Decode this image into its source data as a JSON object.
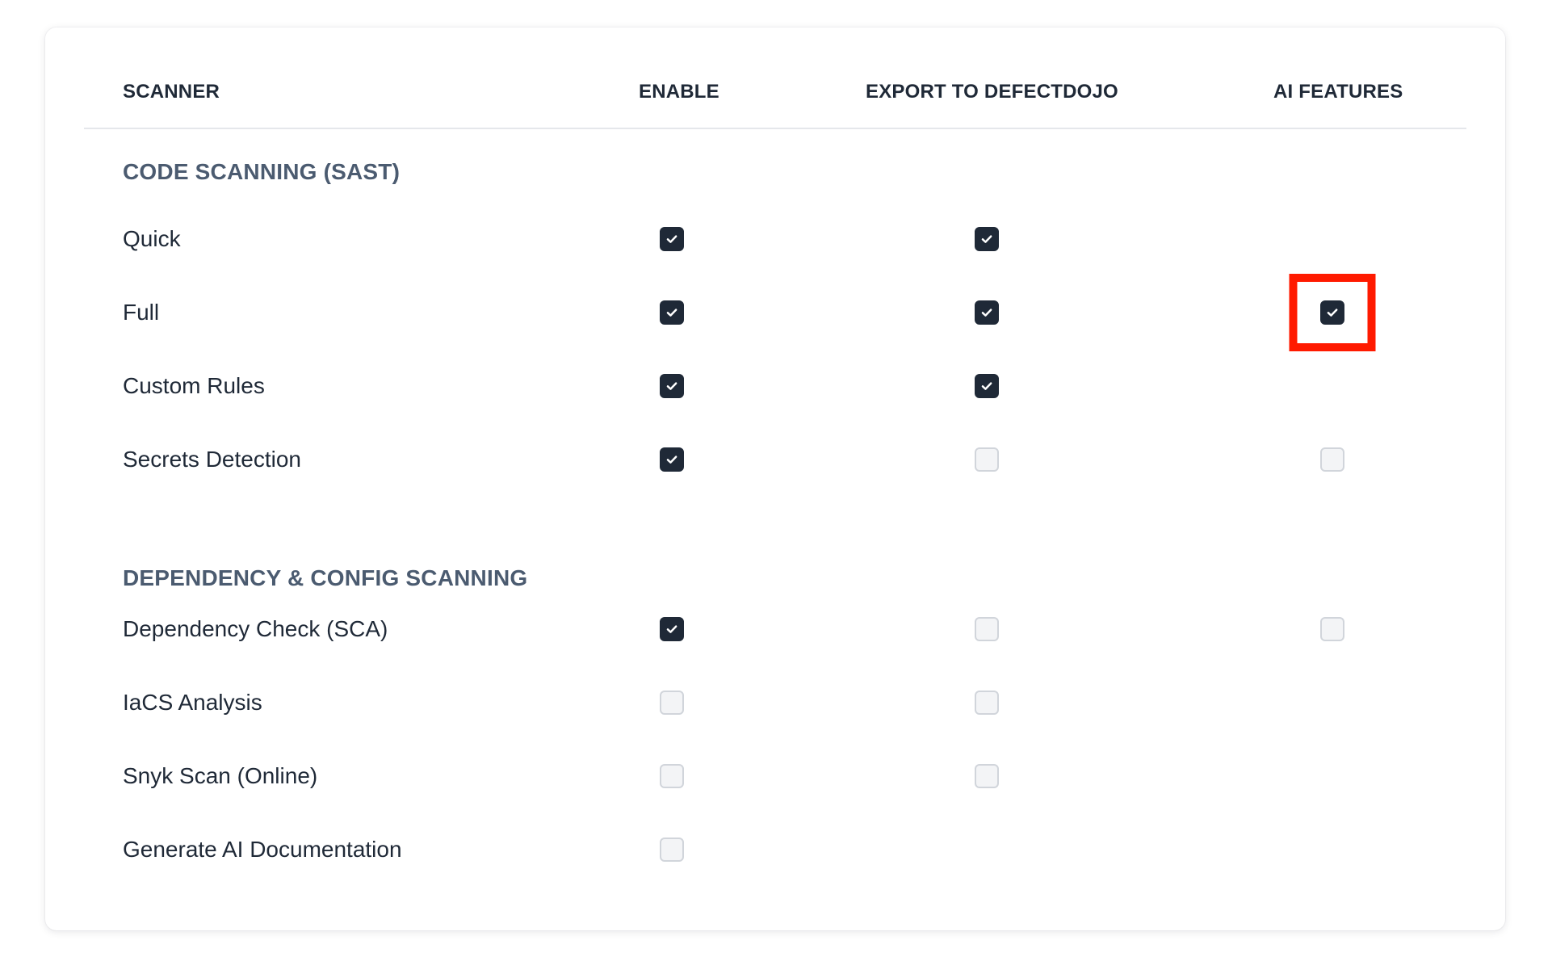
{
  "table": {
    "headers": {
      "scanner": "SCANNER",
      "enable": "ENABLE",
      "export": "EXPORT TO DEFECTDOJO",
      "ai": "AI FEATURES"
    },
    "sections": [
      {
        "title": "CODE SCANNING (SAST)",
        "rows": [
          {
            "label": "Quick",
            "enable": true,
            "export": true,
            "ai": null
          },
          {
            "label": "Full",
            "enable": true,
            "export": true,
            "ai": true
          },
          {
            "label": "Custom Rules",
            "enable": true,
            "export": true,
            "ai": null
          },
          {
            "label": "Secrets Detection",
            "enable": true,
            "export": false,
            "ai": false
          }
        ]
      },
      {
        "title": "DEPENDENCY & CONFIG SCANNING",
        "rows": [
          {
            "label": "Dependency Check (SCA)",
            "enable": true,
            "export": false,
            "ai": false
          },
          {
            "label": "IaCS Analysis",
            "enable": false,
            "export": false,
            "ai": null
          },
          {
            "label": "Snyk Scan (Online)",
            "enable": false,
            "export": false,
            "ai": null
          },
          {
            "label": "Generate AI Documentation",
            "enable": false,
            "export": null,
            "ai": null
          }
        ]
      }
    ]
  },
  "highlight_target": "Full / AI FEATURES",
  "colors": {
    "checked": "#1f2937",
    "unchecked_fill": "#f3f4f6",
    "unchecked_border": "#d1d5db",
    "section_title": "#4b5b70",
    "highlight": "#ff1a00"
  },
  "icons": {
    "check": "check-icon"
  }
}
